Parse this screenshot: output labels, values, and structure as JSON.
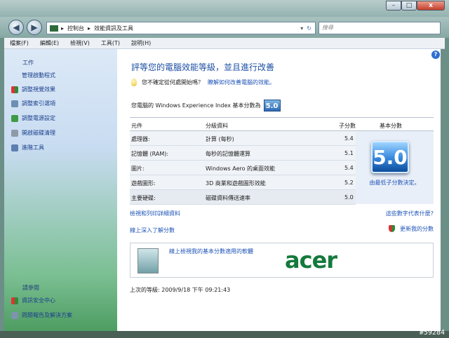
{
  "window": {
    "min": "–",
    "max": "□",
    "close": "x"
  },
  "address": {
    "back_icon": "back-arrow-icon",
    "forward_icon": "forward-arrow-icon",
    "crumbs": [
      "控制台",
      "效能資訊及工具"
    ],
    "refresh": "↻",
    "search_placeholder": "搜尋"
  },
  "menu": [
    "檔案(F)",
    "編輯(E)",
    "檢視(V)",
    "工具(T)",
    "說明(H)"
  ],
  "sidebar": {
    "tasks_title": "工作",
    "tasks": [
      "管理啟動程式",
      "調整視覺效果",
      "調整索引選項",
      "調整電源設定",
      "開啟磁碟清理",
      "進階工具"
    ],
    "see_also_title": "請參閱",
    "see_also": [
      "資訊安全中心",
      "問題報告及解決方案"
    ]
  },
  "main": {
    "heading": "評等您的電腦效能等級，並且進行改善",
    "tip_text": "您不確定從何處開始嗎？",
    "tip_link": "瞭解如何改善電腦的效能。",
    "score_label": "您電腦的 Windows Experience Index 基本分數為",
    "score_value": "5.0",
    "columns": {
      "component": "元件",
      "rated": "分級資料",
      "subscore": "子分數",
      "base": "基本分數"
    },
    "rows": [
      {
        "component": "處理器:",
        "rated": "計算 (每秒)",
        "subscore": "5.4"
      },
      {
        "component": "記憶體 (RAM):",
        "rated": "每秒的記憶體運算",
        "subscore": "5.1"
      },
      {
        "component": "圖片:",
        "rated": "Windows Aero 的桌面效能",
        "subscore": "5.4"
      },
      {
        "component": "遊戲圖形:",
        "rated": "3D 商業和遊戲圖形效能",
        "subscore": "5.2"
      },
      {
        "component": "主要硬碟:",
        "rated": "磁碟資料傳送速率",
        "subscore": "5.0"
      }
    ],
    "base_score": "5.0",
    "base_note": "由最低子分數決定。",
    "link_details": "檢視和列印詳細資料",
    "link_meaning": "這些數字代表什麼?",
    "link_online": "線上深入了解分數",
    "link_update": "更新我的分數",
    "ad_link": "線上檢視我的基本分數適用的軟體",
    "ad_brand": "acer",
    "last_rating": "上次的等級: 2009/9/18 下午 09:21:43"
  },
  "watermark": "#59284"
}
